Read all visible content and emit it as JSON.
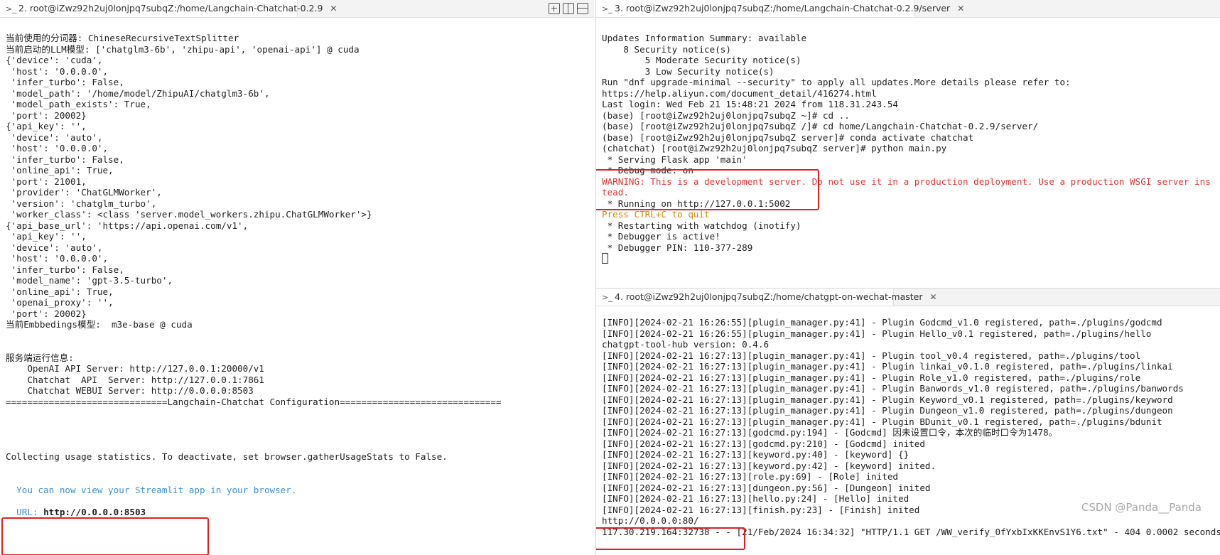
{
  "left_pane": {
    "tab_title": "2. root@iZwz92h2uj0lonjpq7subqZ:/home/Langchain-Chatchat-0.2.9",
    "lines": [
      {
        "text": "当前使用的分词器: ChineseRecursiveTextSplitter",
        "style": ""
      },
      {
        "text": "当前启动的LLM模型: ['chatglm3-6b', 'zhipu-api', 'openai-api'] @ cuda",
        "style": ""
      },
      {
        "text": "{'device': 'cuda',",
        "style": ""
      },
      {
        "text": " 'host': '0.0.0.0',",
        "style": ""
      },
      {
        "text": " 'infer_turbo': False,",
        "style": ""
      },
      {
        "text": " 'model_path': '/home/model/ZhipuAI/chatglm3-6b',",
        "style": ""
      },
      {
        "text": " 'model_path_exists': True,",
        "style": ""
      },
      {
        "text": " 'port': 20002}",
        "style": ""
      },
      {
        "text": "{'api_key': '',",
        "style": ""
      },
      {
        "text": " 'device': 'auto',",
        "style": ""
      },
      {
        "text": " 'host': '0.0.0.0',",
        "style": ""
      },
      {
        "text": " 'infer_turbo': False,",
        "style": ""
      },
      {
        "text": " 'online_api': True,",
        "style": ""
      },
      {
        "text": " 'port': 21001,",
        "style": ""
      },
      {
        "text": " 'provider': 'ChatGLMWorker',",
        "style": ""
      },
      {
        "text": " 'version': 'chatglm_turbo',",
        "style": ""
      },
      {
        "text": " 'worker_class': <class 'server.model_workers.zhipu.ChatGLMWorker'>}",
        "style": ""
      },
      {
        "text": "{'api_base_url': 'https://api.openai.com/v1',",
        "style": ""
      },
      {
        "text": " 'api_key': '',",
        "style": ""
      },
      {
        "text": " 'device': 'auto',",
        "style": ""
      },
      {
        "text": " 'host': '0.0.0.0',",
        "style": ""
      },
      {
        "text": " 'infer_turbo': False,",
        "style": ""
      },
      {
        "text": " 'model_name': 'gpt-3.5-turbo',",
        "style": ""
      },
      {
        "text": " 'online_api': True,",
        "style": ""
      },
      {
        "text": " 'openai_proxy': '',",
        "style": ""
      },
      {
        "text": " 'port': 20002}",
        "style": ""
      },
      {
        "text": "当前Embbedings模型:  m3e-base @ cuda",
        "style": ""
      },
      {
        "text": "",
        "style": ""
      },
      {
        "text": "",
        "style": ""
      },
      {
        "text": "服务端运行信息:",
        "style": ""
      },
      {
        "text": "    OpenAI API Server: http://127.0.0.1:20000/v1",
        "style": ""
      },
      {
        "text": "    Chatchat  API  Server: http://127.0.0.1:7861",
        "style": ""
      },
      {
        "text": "    Chatchat WEBUI Server: http://0.0.0.0:8503",
        "style": ""
      },
      {
        "text": "==============================Langchain-Chatchat Configuration==============================",
        "style": ""
      },
      {
        "text": "",
        "style": ""
      },
      {
        "text": "",
        "style": ""
      },
      {
        "text": "",
        "style": ""
      },
      {
        "text": "",
        "style": ""
      },
      {
        "text": "Collecting usage statistics. To deactivate, set browser.gatherUsageStats to False.",
        "style": ""
      },
      {
        "text": "",
        "style": ""
      },
      {
        "text": "",
        "style": ""
      },
      {
        "text": "  You can now view your Streamlit app in your browser.",
        "style": "blue"
      },
      {
        "text": "",
        "style": ""
      },
      {
        "text": "  URL: http://0.0.0.0:8503",
        "style": "url"
      }
    ]
  },
  "right_top_pane": {
    "tab_title": "3. root@iZwz92h2uj0lonjpq7subqZ:/home/Langchain-Chatchat-0.2.9/server",
    "lines": [
      {
        "text": "Updates Information Summary: available",
        "style": ""
      },
      {
        "text": "    8 Security notice(s)",
        "style": ""
      },
      {
        "text": "        5 Moderate Security notice(s)",
        "style": ""
      },
      {
        "text": "        3 Low Security notice(s)",
        "style": ""
      },
      {
        "text": "Run \"dnf upgrade-minimal --security\" to apply all updates.More details please refer to:",
        "style": ""
      },
      {
        "text": "https://help.aliyun.com/document_detail/416274.html",
        "style": ""
      },
      {
        "text": "Last login: Wed Feb 21 15:48:21 2024 from 118.31.243.54",
        "style": ""
      },
      {
        "text": "(base) [root@iZwz92h2uj0lonjpq7subqZ ~]# cd ..",
        "style": ""
      },
      {
        "text": "(base) [root@iZwz92h2uj0lonjpq7subqZ /]# cd home/Langchain-Chatchat-0.2.9/server/",
        "style": ""
      },
      {
        "text": "(base) [root@iZwz92h2uj0lonjpq7subqZ server]# conda activate chatchat",
        "style": ""
      },
      {
        "text": "(chatchat) [root@iZwz92h2uj0lonjpq7subqZ server]# python main.py",
        "style": ""
      },
      {
        "text": " * Serving Flask app 'main'",
        "style": ""
      },
      {
        "text": " * Debug mode: on",
        "style": ""
      },
      {
        "text": "WARNING: This is a development server. Do not use it in a production deployment. Use a production WSGI server ins",
        "style": "warn"
      },
      {
        "text": "tead.",
        "style": "warn"
      },
      {
        "text": " * Running on http://127.0.0.1:5002",
        "style": ""
      },
      {
        "text": "Press CTRL+C to quit",
        "style": "orange"
      },
      {
        "text": " * Restarting with watchdog (inotify)",
        "style": ""
      },
      {
        "text": " * Debugger is active!",
        "style": ""
      },
      {
        "text": " * Debugger PIN: 110-377-289",
        "style": ""
      }
    ]
  },
  "right_bottom_pane": {
    "tab_title": "4. root@iZwz92h2uj0lonjpq7subqZ:/home/chatgpt-on-wechat-master",
    "lines": [
      {
        "text": "[INFO][2024-02-21 16:26:55][plugin_manager.py:41] - Plugin Godcmd_v1.0 registered, path=./plugins/godcmd",
        "style": ""
      },
      {
        "text": "[INFO][2024-02-21 16:26:55][plugin_manager.py:41] - Plugin Hello_v0.1 registered, path=./plugins/hello",
        "style": ""
      },
      {
        "text": "chatgpt-tool-hub version: 0.4.6",
        "style": ""
      },
      {
        "text": "[INFO][2024-02-21 16:27:13][plugin_manager.py:41] - Plugin tool_v0.4 registered, path=./plugins/tool",
        "style": ""
      },
      {
        "text": "[INFO][2024-02-21 16:27:13][plugin_manager.py:41] - Plugin linkai_v0.1.0 registered, path=./plugins/linkai",
        "style": ""
      },
      {
        "text": "[INFO][2024-02-21 16:27:13][plugin_manager.py:41] - Plugin Role_v1.0 registered, path=./plugins/role",
        "style": ""
      },
      {
        "text": "[INFO][2024-02-21 16:27:13][plugin_manager.py:41] - Plugin Banwords_v1.0 registered, path=./plugins/banwords",
        "style": ""
      },
      {
        "text": "[INFO][2024-02-21 16:27:13][plugin_manager.py:41] - Plugin Keyword_v0.1 registered, path=./plugins/keyword",
        "style": ""
      },
      {
        "text": "[INFO][2024-02-21 16:27:13][plugin_manager.py:41] - Plugin Dungeon_v1.0 registered, path=./plugins/dungeon",
        "style": ""
      },
      {
        "text": "[INFO][2024-02-21 16:27:13][plugin_manager.py:41] - Plugin BDunit_v0.1 registered, path=./plugins/bdunit",
        "style": ""
      },
      {
        "text": "[INFO][2024-02-21 16:27:13][godcmd.py:194] - [Godcmd] 因未设置口令，本次的临时口令为1478。",
        "style": ""
      },
      {
        "text": "[INFO][2024-02-21 16:27:13][godcmd.py:210] - [Godcmd] inited",
        "style": ""
      },
      {
        "text": "[INFO][2024-02-21 16:27:13][keyword.py:40] - [keyword] {}",
        "style": ""
      },
      {
        "text": "[INFO][2024-02-21 16:27:13][keyword.py:42] - [keyword] inited.",
        "style": ""
      },
      {
        "text": "[INFO][2024-02-21 16:27:13][role.py:69] - [Role] inited",
        "style": ""
      },
      {
        "text": "[INFO][2024-02-21 16:27:13][dungeon.py:56] - [Dungeon] inited",
        "style": ""
      },
      {
        "text": "[INFO][2024-02-21 16:27:13][hello.py:24] - [Hello] inited",
        "style": ""
      },
      {
        "text": "[INFO][2024-02-21 16:27:13][finish.py:23] - [Finish] inited",
        "style": ""
      },
      {
        "text": "http://0.0.0.0:80/",
        "style": ""
      },
      {
        "text": "117.30.219.164:32738 - - [21/Feb/2024 16:34:32] \"HTTP/1.1 GET /WW_verify_0fYxbIxKKEnvS1Y6.txt\" - 404 0.0002 seconds",
        "style": ""
      }
    ]
  },
  "watermark": "CSDN @Panda__Panda"
}
